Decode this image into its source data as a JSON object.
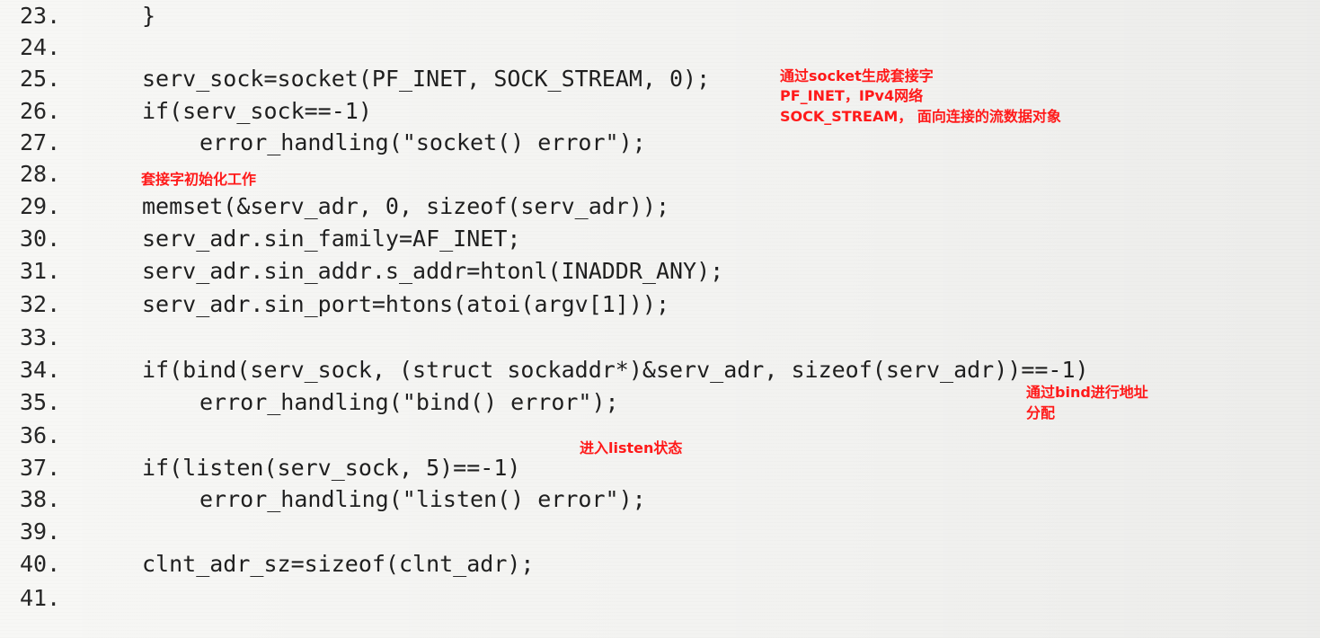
{
  "code_lines": [
    {
      "num": "23.",
      "text": "}"
    },
    {
      "num": "24.",
      "text": ""
    },
    {
      "num": "25.",
      "text": "serv_sock=socket(PF_INET, SOCK_STREAM, 0);"
    },
    {
      "num": "26.",
      "text": "if(serv_sock==-1)"
    },
    {
      "num": "27.",
      "text": "error_handling(\"socket() error\");"
    },
    {
      "num": "28.",
      "text": ""
    },
    {
      "num": "29.",
      "text": "memset(&serv_adr, 0, sizeof(serv_adr));"
    },
    {
      "num": "30.",
      "text": "serv_adr.sin_family=AF_INET;"
    },
    {
      "num": "31.",
      "text": "serv_adr.sin_addr.s_addr=htonl(INADDR_ANY);"
    },
    {
      "num": "32.",
      "text": "serv_adr.sin_port=htons(atoi(argv[1]));"
    },
    {
      "num": "33.",
      "text": ""
    },
    {
      "num": "34.",
      "text": "if(bind(serv_sock, (struct sockaddr*)&serv_adr, sizeof(serv_adr))==-1)"
    },
    {
      "num": "35.",
      "text": "error_handling(\"bind() error\");"
    },
    {
      "num": "36.",
      "text": ""
    },
    {
      "num": "37.",
      "text": "if(listen(serv_sock, 5)==-1)"
    },
    {
      "num": "38.",
      "text": "error_handling(\"listen() error\");"
    },
    {
      "num": "39.",
      "text": ""
    },
    {
      "num": "40.",
      "text": "clnt_adr_sz=sizeof(clnt_adr);"
    },
    {
      "num": "41.",
      "text": ""
    }
  ],
  "annotations": {
    "socket_1": "通过socket生成套接字",
    "socket_2": "PF_INET，IPv4网络",
    "socket_3": "SOCK_STREAM， 面向连接的流数据对象",
    "init": "套接字初始化工作",
    "bind_1": "通过bind进行地址",
    "bind_2": "分配",
    "listen": "进入listen状态"
  },
  "colors": {
    "annotation": "#ff1a1a",
    "code": "#1f1f1f",
    "paper": "#f7f7f5"
  }
}
